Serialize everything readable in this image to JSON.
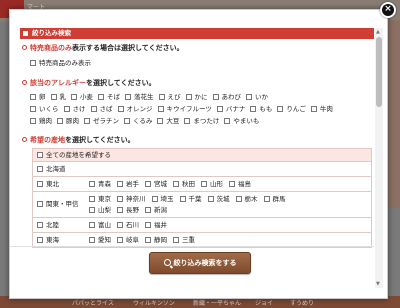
{
  "background": {
    "logo_text": "マート",
    "footer_items": [
      "パパッとライス",
      "ウィルキンソン",
      "新織・一平ちゃん",
      "ジョイ",
      "すうめり"
    ]
  },
  "modal": {
    "title": "絞り込み検索",
    "close_label": "×",
    "special": {
      "heading_pre": "",
      "heading_highlight": "特売商品のみ",
      "heading_post": "表示する場合は選択してください。",
      "option_label": "特売商品のみ表示"
    },
    "allergy": {
      "heading_highlight": "該当のアレルギー",
      "heading_post": "を選択してください。",
      "rows": [
        [
          "卵",
          "乳",
          "小麦",
          "そば",
          "落花生",
          "えび",
          "かに",
          "あわび",
          "いか"
        ],
        [
          "いくら",
          "さけ",
          "さば",
          "オレンジ",
          "キウイフルーツ",
          "バナナ",
          "もも",
          "りんご",
          "牛肉"
        ],
        [
          "鶏肉",
          "豚肉",
          "ゼラチン",
          "くるみ",
          "大豆",
          "まつたけ",
          "やまいも"
        ]
      ]
    },
    "origin": {
      "heading_highlight": "希望の産地",
      "heading_post": "を選択してください。",
      "all_label": "全ての産地を希望する",
      "regions": [
        {
          "name": "北海道",
          "prefs": []
        },
        {
          "name": "東北",
          "prefs": [
            "青森",
            "岩手",
            "宮城",
            "秋田",
            "山形",
            "福島"
          ]
        },
        {
          "name": "関東・甲信",
          "prefs": [
            "東京",
            "神奈川",
            "埼玉",
            "千葉",
            "茨城",
            "栃木",
            "群馬",
            "山梨",
            "長野",
            "新潟"
          ]
        },
        {
          "name": "北陸",
          "prefs": [
            "富山",
            "石川",
            "福井"
          ]
        },
        {
          "name": "東海",
          "prefs": [
            "愛知",
            "岐阜",
            "静岡",
            "三重"
          ]
        }
      ]
    },
    "search_button": "絞り込み検索をする"
  },
  "colors": {
    "accent": "#cf3d34",
    "button": "#8b5634",
    "highlight_row": "#fbe6e2"
  }
}
